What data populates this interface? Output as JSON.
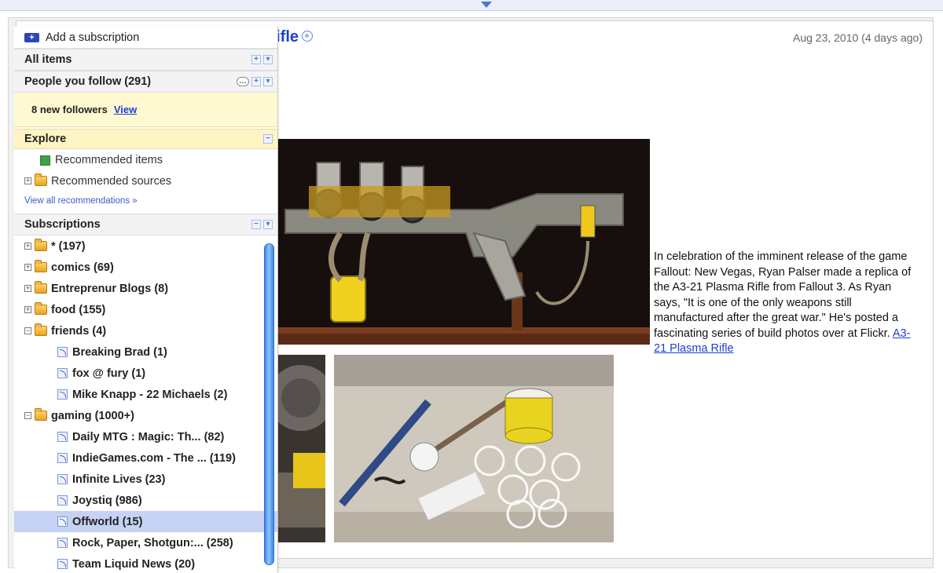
{
  "entry": {
    "title_visible": "a Rifle",
    "date": "Aug 23, 2010 (4 days ago)",
    "body_text": "In celebration of the imminent release of the game Fallout: New Vegas, Ryan Palser made a replica of the A3-21 Plasma Rifle from Fallout 3. As Ryan says, \"It is one of the only weapons still manufactured after the great war.\" He's posted a fascinating series of build photos over at Flickr.",
    "link_text": "A3-21 Plasma Rifle"
  },
  "sidebar": {
    "add_subscription": "Add a subscription",
    "all_items": "All items",
    "people_you_follow": "People you follow (291)",
    "new_followers": "8 new followers",
    "view_link": "View",
    "explore": "Explore",
    "recommended_items": "Recommended items",
    "recommended_sources": "Recommended sources",
    "view_all_recommendations": "View all recommendations »",
    "subscriptions": "Subscriptions",
    "tree": [
      {
        "label": "* (197)",
        "kind": "folder",
        "state": "collapsed"
      },
      {
        "label": "comics (69)",
        "kind": "folder",
        "state": "collapsed"
      },
      {
        "label": "Entreprenur Blogs (8)",
        "kind": "folder",
        "state": "collapsed"
      },
      {
        "label": "food (155)",
        "kind": "folder",
        "state": "collapsed"
      },
      {
        "label": "friends (4)",
        "kind": "folder",
        "state": "expanded"
      },
      {
        "label": "Breaking Brad (1)",
        "kind": "feed"
      },
      {
        "label": "fox @ fury (1)",
        "kind": "feed"
      },
      {
        "label": "Mike Knapp - 22 Michaels (2)",
        "kind": "feed"
      },
      {
        "label": "gaming (1000+)",
        "kind": "folder",
        "state": "expanded"
      },
      {
        "label": "Daily MTG : Magic: Th... (82)",
        "kind": "feed"
      },
      {
        "label": "IndieGames.com - The ... (119)",
        "kind": "feed"
      },
      {
        "label": "Infinite Lives (23)",
        "kind": "feed"
      },
      {
        "label": "Joystiq (986)",
        "kind": "feed"
      },
      {
        "label": "Offworld (15)",
        "kind": "feed",
        "selected": true
      },
      {
        "label": "Rock, Paper, Shotgun:... (258)",
        "kind": "feed"
      },
      {
        "label": "Team Liquid News (20)",
        "kind": "feed"
      }
    ]
  },
  "colors": {
    "link": "#1f3fd1",
    "highlight_yellow": "#fff5c4",
    "selected_row": "#c5d2f3",
    "scrollbar": "#5ea4f0"
  }
}
